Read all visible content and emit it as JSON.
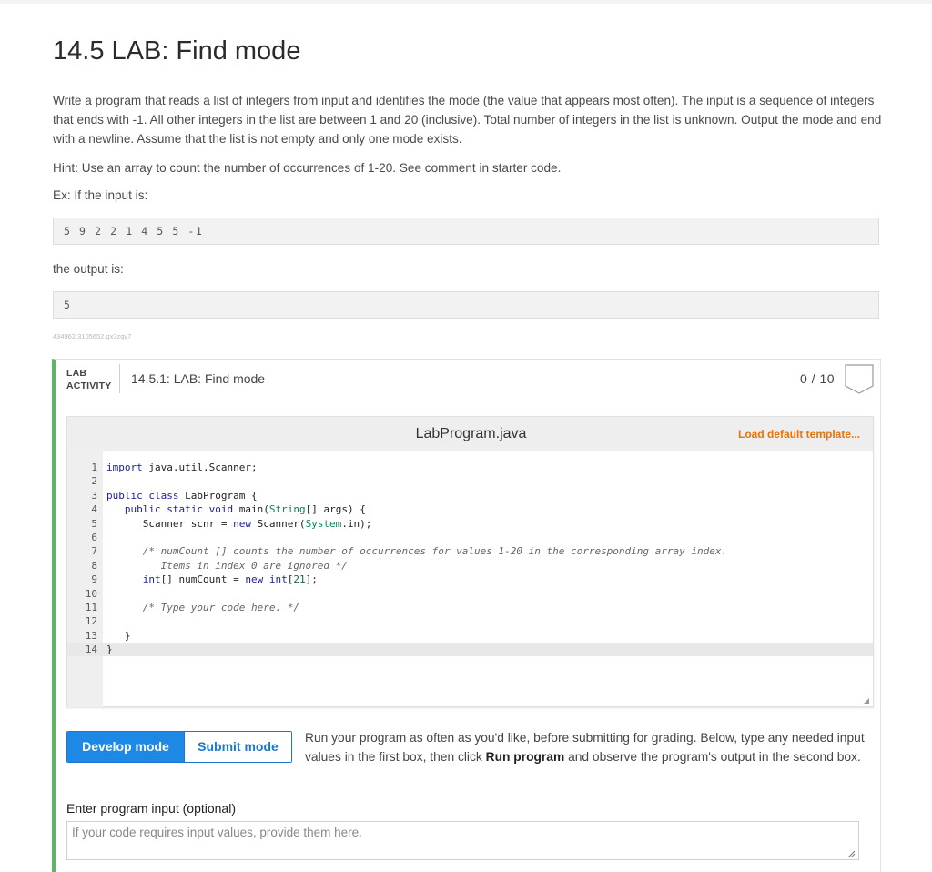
{
  "page": {
    "title": "14.5 LAB: Find mode",
    "description": "Write a program that reads a list of integers from input and identifies the mode (the value that appears most often). The input is a sequence of integers that ends with -1. All other integers in the list are between 1 and 20 (inclusive). Total number of integers in the list is unknown. Output the mode and end with a newline. Assume that the list is not empty and only one mode exists.",
    "hint": "Hint: Use an array to count the number of occurrences of 1-20. See comment in starter code.",
    "example_intro": "Ex: If the input is:",
    "example_input": "5 9 2 2 1 4 5 5 -1",
    "output_intro": "the output is:",
    "example_output": "5",
    "tracking_id": "434962.3105652.qx3zqy7"
  },
  "lab": {
    "label_line1": "LAB",
    "label_line2": "ACTIVITY",
    "title": "14.5.1: LAB: Find mode",
    "score": "0 / 10",
    "badge_icon": "shield-badge-icon",
    "accent_color": "#5cb85c"
  },
  "editor": {
    "filename": "LabProgram.java",
    "load_template": "Load default template...",
    "active_line": 14,
    "lines": [
      {
        "n": "1",
        "code": "import java.util.Scanner;"
      },
      {
        "n": "2",
        "code": ""
      },
      {
        "n": "3",
        "code": "public class LabProgram {"
      },
      {
        "n": "4",
        "code": "   public static void main(String[] args) {"
      },
      {
        "n": "5",
        "code": "      Scanner scnr = new Scanner(System.in);"
      },
      {
        "n": "6",
        "code": ""
      },
      {
        "n": "7",
        "code": "      /* numCount [] counts the number of occurrences for values 1-20 in the corresponding array index."
      },
      {
        "n": "8",
        "code": "         Items in index 0 are ignored */"
      },
      {
        "n": "9",
        "code": "      int[] numCount = new int[21];"
      },
      {
        "n": "10",
        "code": ""
      },
      {
        "n": "11",
        "code": "      /* Type your code here. */"
      },
      {
        "n": "12",
        "code": ""
      },
      {
        "n": "13",
        "code": "   }"
      },
      {
        "n": "14",
        "code": "}"
      }
    ]
  },
  "modes": {
    "develop": "Develop mode",
    "submit": "Submit mode",
    "active": "develop",
    "accent_color": "#1e88e5"
  },
  "run_instructions": {
    "part1": "Run your program as often as you'd like, before submitting for grading. Below, type any needed input values in the first box, then click ",
    "bold": "Run program",
    "part2": " and observe the program's output in the second box."
  },
  "program_input": {
    "label": "Enter program input (optional)",
    "placeholder": "If your code requires input values, provide them here.",
    "value": ""
  }
}
